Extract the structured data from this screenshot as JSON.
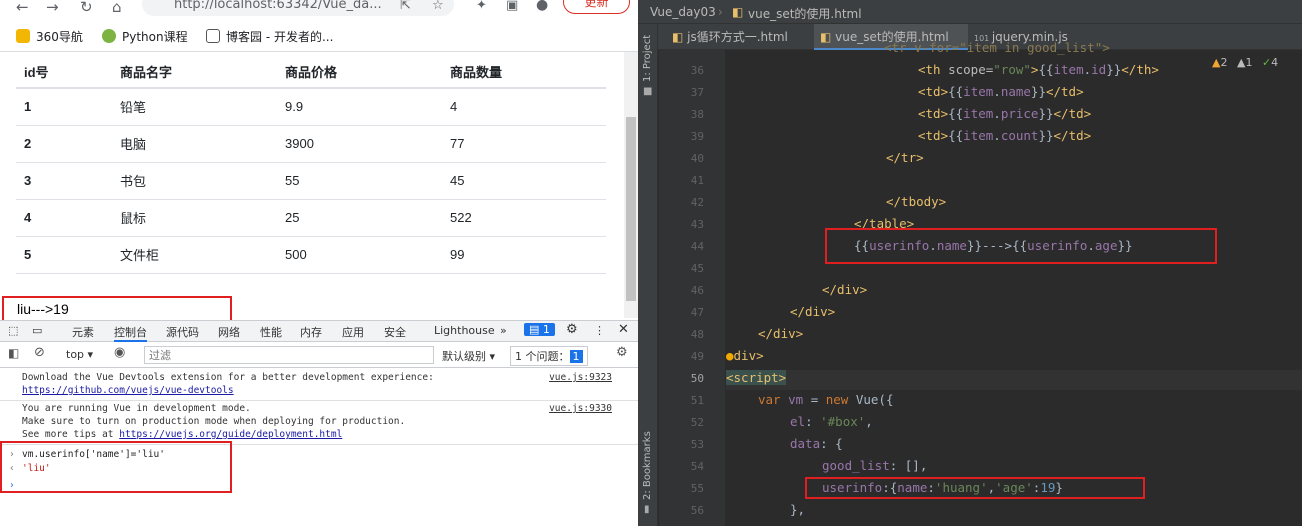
{
  "browser": {
    "url": "http://localhost:63342/Vue_da...",
    "update_label": "更新",
    "bookmarks": [
      {
        "label": "360导航",
        "color": "#3cba54"
      },
      {
        "label": "Python课程",
        "color": "#7cb342"
      },
      {
        "label": "博客园 - 开发者的...",
        "color": "#444444"
      }
    ],
    "table": {
      "headers": [
        "id号",
        "商品名字",
        "商品价格",
        "商品数量"
      ],
      "rows": [
        [
          "1",
          "铅笔",
          "9.9",
          "4"
        ],
        [
          "2",
          "电脑",
          "3900",
          "77"
        ],
        [
          "3",
          "书包",
          "55",
          "45"
        ],
        [
          "4",
          "鼠标",
          "25",
          "522"
        ],
        [
          "5",
          "文件柜",
          "500",
          "99"
        ]
      ]
    },
    "result_text": "liu--->19"
  },
  "devtools": {
    "tabs": [
      "元素",
      "控制台",
      "源代码",
      "网络",
      "性能",
      "内存",
      "应用",
      "安全",
      "Lighthouse"
    ],
    "badge": "1",
    "context": "top",
    "filter_placeholder": "过滤",
    "level": "默认级别",
    "issues": "1 个问题：",
    "issues_count": "1",
    "messages": [
      {
        "lines": [
          "Download the Vue Devtools extension for a better development experience:"
        ],
        "link": "https://github.com/vuejs/vue-devtools",
        "source": "vue.js:9323"
      },
      {
        "lines": [
          "You are running Vue in development mode.",
          "Make sure to turn on production mode when deploying for production.",
          "See more tips at "
        ],
        "link": "https://vuejs.org/guide/deployment.html",
        "source": "vue.js:9330"
      }
    ],
    "input_cmd": "vm.userinfo['name']='liu'",
    "output": "'liu'"
  },
  "editor": {
    "breadcrumb_project": "Vue_day03",
    "breadcrumb_file": "vue_set的使用.html",
    "tabs": [
      "js循环方式一.html",
      "vue_set的使用.html",
      "jquery.min.js"
    ],
    "side_project": "1: Project",
    "side_bookmarks": "2: Bookmarks",
    "warnings": {
      "warn": "2",
      "weak": "1",
      "ok": "4"
    },
    "line_numbers": [
      "36",
      "37",
      "38",
      "39",
      "40",
      "41",
      "42",
      "43",
      "44",
      "45",
      "46",
      "47",
      "48",
      "49",
      "50",
      "51",
      "52",
      "53",
      "54",
      "55",
      "56"
    ],
    "top_partial": "<tr v-for=\"item in good_list\">"
  }
}
